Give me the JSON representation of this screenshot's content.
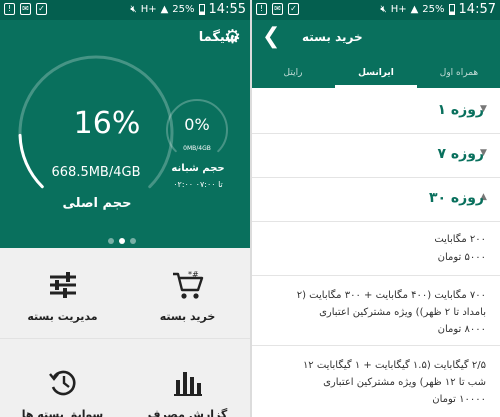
{
  "status_left": {
    "time": "14:55",
    "battery": "25%",
    "network": "H+"
  },
  "status_right": {
    "time": "14:57",
    "battery": "25%",
    "network": "H+"
  },
  "left_screen": {
    "title": "سیگما",
    "main_gauge": {
      "percent_text": "16%",
      "usage_text": "668.5MB/4GB",
      "label": "حجم اصلی",
      "fraction": 0.16
    },
    "night_gauge": {
      "percent_text": "0%",
      "size_text": "0MB/4GB",
      "label": "حجم شبانه",
      "hours": "۰۲:۰۰ تا ۰۷:۰۰",
      "fraction": 0.0
    },
    "tiles": {
      "buy": "خرید بسته",
      "manage": "مدیریت بسته",
      "report": "گزارش مصرف",
      "history": "سوابق بسته ها"
    }
  },
  "right_screen": {
    "title": "خرید بسته",
    "tabs": [
      "رایتل",
      "ایرانسل",
      "همراه اول"
    ],
    "active_tab": "ایرانسل",
    "sections": [
      "۱ روزه",
      "۷ روزه",
      "۳۰ روزه"
    ],
    "packages": [
      {
        "line1": "۲۰۰ مگابایت",
        "line2": "۵۰۰۰ تومان"
      },
      {
        "line1": "۷۰۰ مگابایت (۴۰۰ مگابایت + ۳۰۰ مگابایت (۲",
        "line2": "بامداد تا ۲ ظهر)) ویژه مشترکین اعتباری",
        "line3": "۸۰۰۰ تومان"
      },
      {
        "line1": "۲/۵ گیگابایت (۱.۵ گیگابایت + ۱ گیگابایت ۱۲",
        "line2": "شب تا ۱۲ ظهر) ویژه مشترکین اعتباری",
        "line3": "۱۰۰۰۰ تومان"
      }
    ]
  },
  "colors": {
    "primary": "#09705d",
    "status_bar": "#045f4f",
    "tile_background": "#f0f0f0"
  },
  "icons": {
    "settings": "gear-icon",
    "back": "chevron-left-icon",
    "buy": "cart-icon",
    "manage": "sliders-icon",
    "report": "bar-chart-icon",
    "history": "history-icon"
  }
}
